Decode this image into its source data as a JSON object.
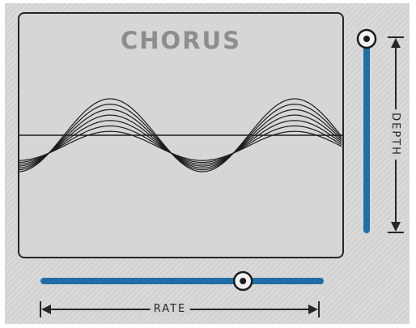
{
  "title": "CHORUS",
  "colors": {
    "accent": "#1f6fa6",
    "wave": "#1c1c1c",
    "display_bg": "#d6d6d6",
    "panel_bg": "#d3d3d3",
    "label_text": "#8d8d8d"
  },
  "depth": {
    "label": "DEPTH",
    "value": 1.0
  },
  "rate": {
    "label": "RATE",
    "value": 0.72
  },
  "waveform": {
    "line_count": 7,
    "cycles": 1.75
  }
}
